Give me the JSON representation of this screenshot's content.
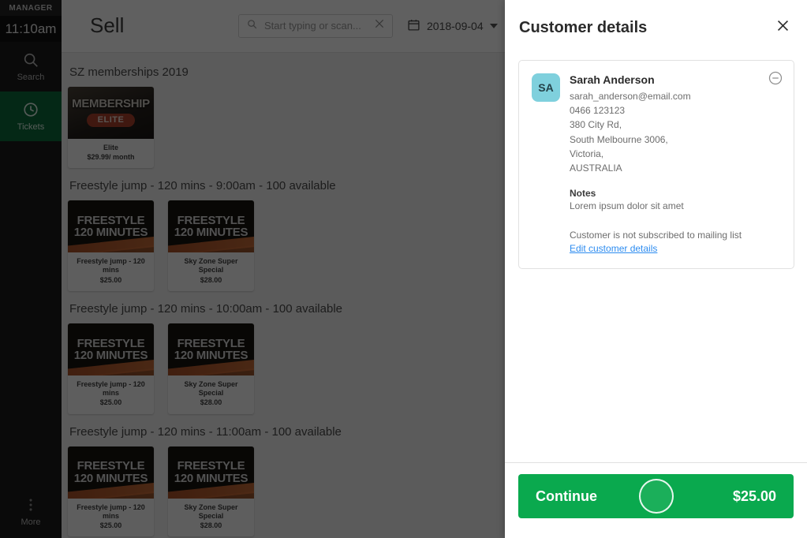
{
  "sidebar": {
    "role": "MANAGER",
    "clock": "11:10am",
    "items": [
      {
        "label": "Search",
        "icon": "search-icon"
      },
      {
        "label": "Tickets",
        "icon": "clock-icon"
      },
      {
        "label": "More",
        "icon": "more-vertical-icon"
      }
    ]
  },
  "topbar": {
    "title": "Sell",
    "search_placeholder": "Start typing or scan...",
    "search_value": "",
    "search_icon": "search-icon",
    "clear_icon": "close-icon",
    "calendar_icon": "calendar-icon",
    "date": "2018-09-04",
    "caret_icon": "chevron-down-icon"
  },
  "catalog": {
    "groups": [
      {
        "title": "SZ memberships 2019",
        "products": [
          {
            "thumb_line1": "MEMBERSHIP",
            "thumb_badge": "ELITE",
            "thumb_style": "membership",
            "name": "Elite",
            "price": "$29.99/ month"
          }
        ]
      },
      {
        "title": "Freestyle jump - 120 mins - 9:00am - 100 available",
        "products": [
          {
            "thumb_line1": "FREESTYLE",
            "thumb_line2": "120 MINUTES",
            "thumb_style": "freestyle",
            "name": "Freestyle jump - 120 mins",
            "price": "$25.00"
          },
          {
            "thumb_line1": "FREESTYLE",
            "thumb_line2": "120 MINUTES",
            "thumb_style": "freestyle",
            "name": "Sky Zone Super Special",
            "price": "$28.00"
          }
        ]
      },
      {
        "title": "Freestyle jump - 120 mins - 10:00am - 100 available",
        "products": [
          {
            "thumb_line1": "FREESTYLE",
            "thumb_line2": "120 MINUTES",
            "thumb_style": "freestyle",
            "name": "Freestyle jump - 120 mins",
            "price": "$25.00"
          },
          {
            "thumb_line1": "FREESTYLE",
            "thumb_line2": "120 MINUTES",
            "thumb_style": "freestyle",
            "name": "Sky Zone Super Special",
            "price": "$28.00"
          }
        ]
      },
      {
        "title": "Freestyle jump - 120 mins - 11:00am - 100 available",
        "products": [
          {
            "thumb_line1": "FREESTYLE",
            "thumb_line2": "120 MINUTES",
            "thumb_style": "freestyle",
            "name": "Freestyle jump - 120 mins",
            "price": "$25.00"
          },
          {
            "thumb_line1": "FREESTYLE",
            "thumb_line2": "120 MINUTES",
            "thumb_style": "freestyle",
            "name": "Sky Zone Super Special",
            "price": "$28.00"
          }
        ]
      }
    ]
  },
  "drawer": {
    "title": "Customer details",
    "close_icon": "close-icon",
    "customer": {
      "initials": "SA",
      "name": "Sarah Anderson",
      "email": "sarah_anderson@email.com",
      "phone": "0466 123123",
      "address_line1": "380 City Rd,",
      "address_line2": "South Melbourne 3006,",
      "address_line3": "Victoria,",
      "address_line4": "AUSTRALIA",
      "notes_heading": "Notes",
      "notes_body": "Lorem ipsum dolor sit amet",
      "subscription_status": "Customer is not subscribed to mailing list",
      "edit_link": "Edit customer details",
      "remove_icon": "minus-circle-icon"
    },
    "footer": {
      "continue_label": "Continue",
      "amount": "$25.00",
      "accent_color": "#0aa94e"
    }
  },
  "colors": {
    "brand_green": "#0aa94e",
    "sidebar_active_green": "#0b6b3a",
    "avatar_teal": "#7fd0dd",
    "link_blue": "#2d8cf0",
    "scrim": "rgba(0,0,0,0.62)"
  }
}
